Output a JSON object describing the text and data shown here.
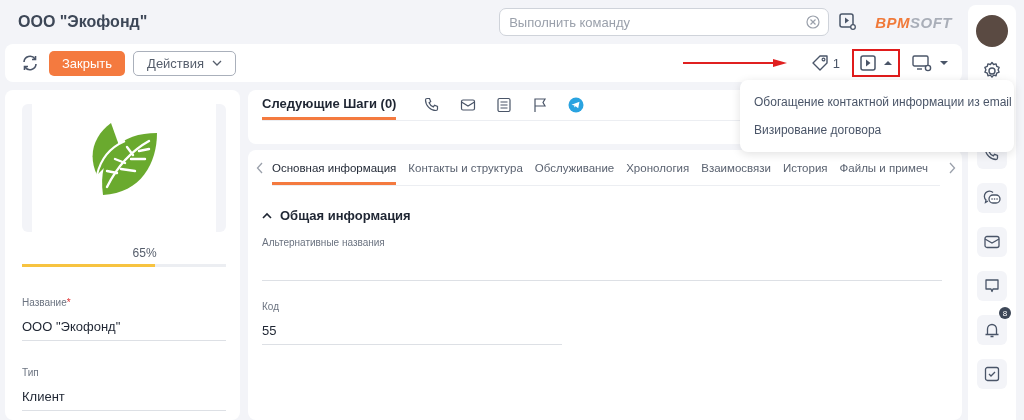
{
  "header": {
    "title": "ООО \"Экофонд\"",
    "command_search": {
      "placeholder": "Выполнить команду"
    },
    "logo": {
      "part_1": "BPM",
      "part_2": "SOFT"
    }
  },
  "toolbar": {
    "buttons": [
      {
        "label": "Закрыть",
        "kind": "primary"
      },
      {
        "label": "Действия",
        "kind": "dropdown"
      }
    ],
    "tags_count": "1",
    "process_menu": {
      "expanded": true,
      "items": [
        "Обогащение контактной информации из email",
        "Визирование договора"
      ]
    }
  },
  "profile": {
    "completeness": "65%",
    "level": 0.65,
    "fields": [
      {
        "label": "Название",
        "required_mark": "*",
        "value": "ООО \"Экофонд\""
      },
      {
        "label": "Тип",
        "value": "Клиент"
      }
    ]
  },
  "next_steps": {
    "title": "Следующие Шаги (0)",
    "selected": true
  },
  "tabs": [
    {
      "label": "Основная информация",
      "selected": true
    },
    {
      "label": "Контакты и структура",
      "selected": false
    },
    {
      "label": "Обслуживание",
      "selected": false
    },
    {
      "label": "Хронология",
      "selected": false
    },
    {
      "label": "Взаимосвязи",
      "selected": false
    },
    {
      "label": "История",
      "selected": false
    },
    {
      "label": "Файлы и примеч",
      "selected": false
    }
  ],
  "section": {
    "title": "Общая информация",
    "expanded": true,
    "fields": [
      {
        "label": "Альтернативные названия"
      },
      {
        "label": "Код",
        "value": "55"
      }
    ]
  },
  "right_panel": {
    "notifications_badge": "8"
  }
}
